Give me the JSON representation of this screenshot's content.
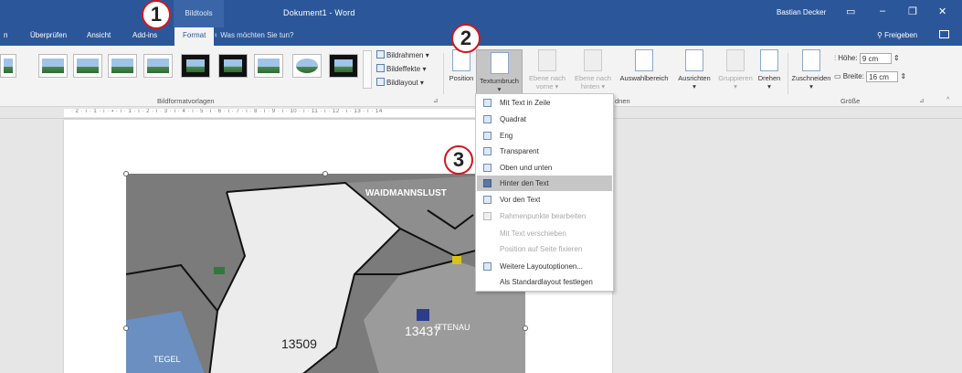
{
  "titlebar": {
    "context_tab": "Bildtools",
    "document_title": "Dokument1 - Word",
    "user": "Bastian Decker"
  },
  "tabs": {
    "items": [
      "n",
      "Überprüfen",
      "Ansicht",
      "Add-ins",
      "Format"
    ],
    "active": "Format",
    "tell_me": "Was möchten Sie tun?",
    "share": "Freigeben"
  },
  "ribbon": {
    "picture_options": [
      "Bildrahmen",
      "Bildeffekte",
      "Bildlayout"
    ],
    "group_styles": "Bildformatvorlagen",
    "arrange_buttons": [
      {
        "label": "Position",
        "sub": "",
        "disabled": false
      },
      {
        "label": "Textumbruch",
        "sub": "",
        "disabled": false
      },
      {
        "label": "Ebene nach",
        "sub": "vorne",
        "disabled": true
      },
      {
        "label": "Ebene nach",
        "sub": "hinten",
        "disabled": true
      },
      {
        "label": "Auswahlbereich",
        "sub": "",
        "disabled": false
      },
      {
        "label": "Ausrichten",
        "sub": "",
        "disabled": false
      },
      {
        "label": "Gruppieren",
        "sub": "",
        "disabled": true
      },
      {
        "label": "Drehen",
        "sub": "",
        "disabled": false
      }
    ],
    "group_arrange_partial": "dnen",
    "crop": "Zuschneiden",
    "height_label": "Höhe:",
    "height_value": "9 cm",
    "width_label": "Breite:",
    "width_value": "16 cm",
    "group_size": "Größe"
  },
  "ruler": {
    "marks": "· 2 · ı · 1 · ı · ▪ · ı · 1 · ı · 2 · ı · 3 · ı · 4 · ı · 5 · ı · 6 · ı · 7 · ı · 8 · ı · 9 · ı · 10 · ı · 11 · ı · 12 · ı · 13 · ı · 14"
  },
  "wrap_menu": {
    "items": [
      {
        "label": "Mit Text in Zeile",
        "disabled": false,
        "icon": true
      },
      {
        "label": "Quadrat",
        "disabled": false,
        "icon": true
      },
      {
        "label": "Eng",
        "disabled": false,
        "icon": true
      },
      {
        "label": "Transparent",
        "disabled": false,
        "icon": true
      },
      {
        "label": "Oben und unten",
        "disabled": false,
        "icon": true
      },
      {
        "label": "Hinter den Text",
        "disabled": false,
        "icon": true,
        "selected": true
      },
      {
        "label": "Vor den Text",
        "disabled": false,
        "icon": true
      },
      {
        "label": "Rahmenpunkte bearbeiten",
        "disabled": true,
        "icon": true
      },
      {
        "label": "Mit Text verschieben",
        "disabled": true,
        "icon": false
      },
      {
        "label": "Position auf Seite fixieren",
        "disabled": true,
        "icon": false
      },
      {
        "label": "Weitere Layoutoptionen...",
        "disabled": false,
        "icon": true
      },
      {
        "label": "Als Standardlayout festlegen",
        "disabled": false,
        "icon": false
      }
    ]
  },
  "map": {
    "labels": [
      "WAIDMANNSLUST",
      "TEGEL",
      "13509",
      "13437",
      "ITTENAU"
    ]
  },
  "callouts": [
    "1",
    "2",
    "3"
  ],
  "colors": {
    "word_blue": "#2b579a",
    "callout_red": "#d4161c",
    "menu_highlight": "#c6c6c6"
  }
}
